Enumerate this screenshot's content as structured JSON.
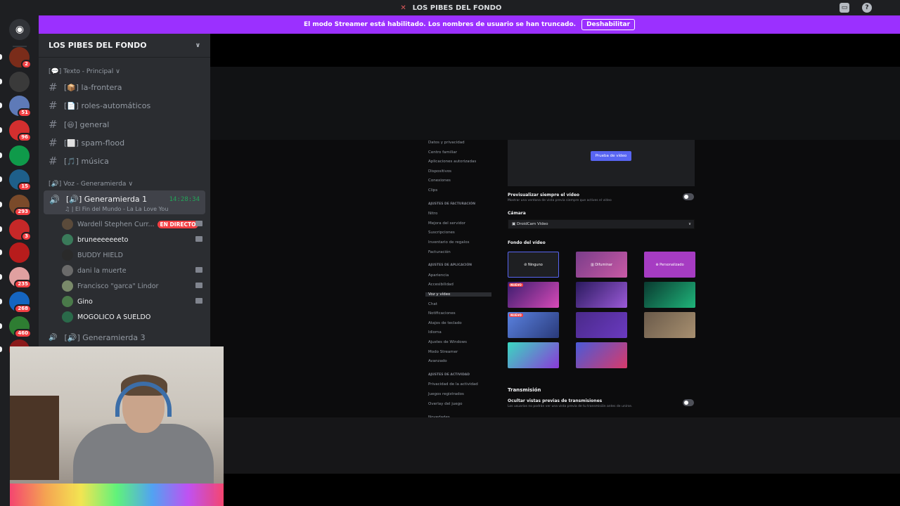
{
  "titlebar": {
    "title": "LOS PIBES DEL FONDO"
  },
  "banner": {
    "text": "El modo Streamer está habilitado. Los nombres de usuario se han truncado.",
    "button": "Deshabilitar"
  },
  "rail": {
    "servers": [
      {
        "badge": "2",
        "color": "#7a2c1a"
      },
      {
        "badge": "",
        "color": "#3a3a3a"
      },
      {
        "badge": "51",
        "color": "#5e7ab8"
      },
      {
        "badge": "96",
        "color": "#d32f2f"
      },
      {
        "badge": "",
        "color": "#0f9a4a"
      },
      {
        "badge": "15",
        "color": "#1e5f8a"
      },
      {
        "badge": "293",
        "color": "#7a4a2a"
      },
      {
        "badge": "3",
        "color": "#c62828"
      },
      {
        "badge": "",
        "color": "#b71c1c"
      },
      {
        "badge": "235",
        "color": "#e0a0a0"
      },
      {
        "badge": "268",
        "color": "#1565c0"
      },
      {
        "badge": "460",
        "color": "#2e7d32"
      },
      {
        "badge": "",
        "color": "#8b1a1a"
      }
    ]
  },
  "sidebar": {
    "server_name": "LOS PIBES DEL FONDO",
    "text_category": "Texto - Principal",
    "text_channels": [
      {
        "emoji": "📦",
        "name": "la-frontera"
      },
      {
        "emoji": "📄",
        "name": "roles-automáticos"
      },
      {
        "emoji": "😃",
        "name": "general"
      },
      {
        "emoji": "⬜",
        "name": "spam-flood"
      },
      {
        "emoji": "🎵",
        "name": "música"
      }
    ],
    "voice_category": "Voz - Generamierda",
    "voice_channel": {
      "name": "Generamierda 1",
      "time": "14:28:34",
      "activity": "El Fin del Mundo - La La Love You"
    },
    "members": [
      {
        "name": "Wardell Stephen Curr...",
        "live": "EN DIRECTO",
        "on": false,
        "cam": true
      },
      {
        "name": "bruneeeeeeeto",
        "live": "",
        "on": true,
        "cam": true
      },
      {
        "name": "BUDDY HIELD",
        "live": "",
        "on": false,
        "cam": false
      },
      {
        "name": "dani la muerte",
        "live": "",
        "on": false,
        "cam": true
      },
      {
        "name": "Francisco \"garca\" Lindor",
        "live": "",
        "on": false,
        "cam": true
      },
      {
        "name": "Gino",
        "live": "",
        "on": true,
        "cam": true
      },
      {
        "name": "MOGOLICO A SUELDO",
        "live": "",
        "on": true,
        "cam": false
      }
    ],
    "voice_channel_3": "Generamierda 3"
  },
  "settings_nav": {
    "items1": [
      "Datos y privacidad",
      "Centro familiar",
      "Aplicaciones autorizadas",
      "Dispositivos",
      "Conexiones",
      "Clips"
    ],
    "billing_header": "AJUSTES DE FACTURACIÓN",
    "items2": [
      "Nitro",
      "Mejora del servidor",
      "Suscripciones",
      "Inventario de regalos",
      "Facturación"
    ],
    "app_header": "AJUSTES DE APLICACIÓN",
    "items3": [
      "Apariencia",
      "Accesibilidad",
      "Voz y vídeo",
      "Chat",
      "Notificaciones",
      "Atajos de teclado",
      "Idioma",
      "Ajustes de Windows",
      "Modo Streamer",
      "Avanzado"
    ],
    "activity_header": "AJUSTES DE ACTIVIDAD",
    "items4": [
      "Privacidad de la actividad",
      "Juegos registrados",
      "Overlay del juego"
    ],
    "items5": [
      "Novedades"
    ]
  },
  "settings": {
    "test_video": "Prueba de vídeo",
    "always_preview": "Previsualizar siempre el vídeo",
    "always_preview_desc": "Mostrar una ventana de vista previa siempre que actives el vídeo",
    "camera_label": "Cámara",
    "camera_value": "DroidCam Video",
    "background_label": "Fondo del vídeo",
    "bg_none": "Ninguno",
    "bg_blur": "Difuminar",
    "bg_custom": "Personalizado",
    "new_badge": "NUEVO",
    "stream_header": "Transmisión",
    "hide_previews": "Ocultar vistas previas de transmisiones",
    "hide_previews_desc": "Los usuarios no podrán ver una vista previa de tu transmisión antes de unirse."
  }
}
